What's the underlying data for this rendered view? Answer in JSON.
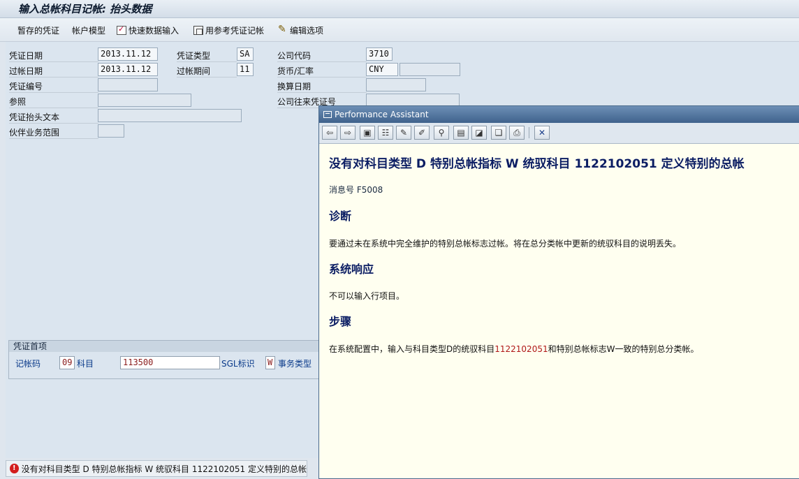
{
  "window": {
    "title": "输入总帐科目记帐: 抬头数据"
  },
  "toolbar": {
    "parked_doc": "暂存的凭证",
    "account_model": "帐户模型",
    "fast_entry": "快速数据输入",
    "post_with_reference": "用参考凭证记帐",
    "editing_options": "编辑选项"
  },
  "header": {
    "doc_date": {
      "label": "凭证日期",
      "value": "2013.11.12"
    },
    "doc_type": {
      "label": "凭证类型",
      "value": "SA"
    },
    "company_code": {
      "label": "公司代码",
      "value": "3710"
    },
    "posting_date": {
      "label": "过帐日期",
      "value": "2013.11.12"
    },
    "period": {
      "label": "过帐期间",
      "value": "11"
    },
    "currency": {
      "label": "货币/汇率",
      "value": "CNY",
      "rate": ""
    },
    "doc_number": {
      "label": "凭证编号",
      "value": ""
    },
    "translation_date": {
      "label": "换算日期",
      "value": ""
    },
    "reference": {
      "label": "参照",
      "value": ""
    },
    "cross_cc_number": {
      "label": "公司往来凭证号",
      "value": ""
    },
    "header_text": {
      "label": "凭证抬头文本",
      "value": ""
    },
    "trading_partner": {
      "label": "伙伴业务范围",
      "value": ""
    }
  },
  "first_item": {
    "title": "凭证首项",
    "posting_key_label": "记帐码",
    "posting_key": "09",
    "account_label": "科目",
    "account": "113500",
    "sgl_label": "SGL标识",
    "sgl": "W",
    "transaction_type_label": "事务类型"
  },
  "status": {
    "icon": "error-icon",
    "message": "没有对科目类型 D 特别总帐指标 W 统驭科目 1122102051 定义特别的总帐"
  },
  "assistant": {
    "title": "Performance Assistant",
    "heading": "没有对科目类型 D 特别总帐指标 W 统驭科目 1122102051 定义特别的总帐",
    "msg_no_label": "消息号",
    "msg_no": "F5008",
    "diagnosis_title": "诊断",
    "diagnosis_text": "要通过未在系统中完全维护的特别总帐标志过帐。将在总分类帐中更新的统驭科目的说明丢失。",
    "response_title": "系统响应",
    "response_text": "不可以输入行项目。",
    "procedure_title": "步骤",
    "procedure_text_1": "在系统配置中，输入与科目类型D的统驭科目",
    "procedure_account": "1122102051",
    "procedure_text_2": "和特别总帐标志W一致的特别总分类帐。"
  }
}
